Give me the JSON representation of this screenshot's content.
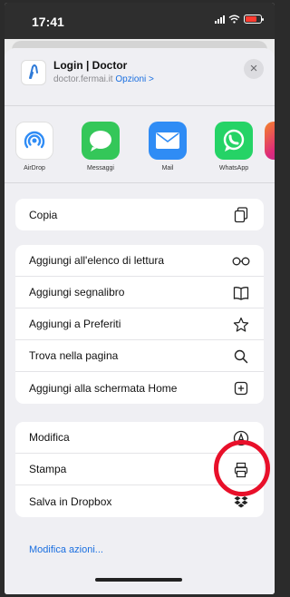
{
  "status_bar": {
    "time": "17:41"
  },
  "share_header": {
    "title": "Login | Doctor",
    "url": "doctor.fermai.it",
    "options_label": "Opzioni >",
    "close_label": "×"
  },
  "apps": [
    {
      "label": "AirDrop",
      "icon": "airdrop-icon"
    },
    {
      "label": "Messaggi",
      "icon": "messages-icon"
    },
    {
      "label": "Mail",
      "icon": "mail-icon"
    },
    {
      "label": "WhatsApp",
      "icon": "whatsapp-icon"
    },
    {
      "label": "I",
      "icon": "instagram-icon"
    }
  ],
  "actions": {
    "copy": {
      "label": "Copia",
      "icon": "copy-icon"
    },
    "group2": [
      {
        "label": "Aggiungi all'elenco di lettura",
        "icon": "glasses-icon"
      },
      {
        "label": "Aggiungi segnalibro",
        "icon": "book-icon"
      },
      {
        "label": "Aggiungi a Preferiti",
        "icon": "star-icon"
      },
      {
        "label": "Trova nella pagina",
        "icon": "search-icon"
      },
      {
        "label": "Aggiungi alla schermata Home",
        "icon": "add-square-icon"
      }
    ],
    "group3": [
      {
        "label": "Modifica",
        "icon": "markup-icon"
      },
      {
        "label": "Stampa",
        "icon": "printer-icon"
      },
      {
        "label": "Salva in Dropbox",
        "icon": "dropbox-icon"
      }
    ]
  },
  "edit_actions_label": "Modifica azioni...",
  "colors": {
    "accent": "#1a6fe0",
    "annotation": "#e8102a",
    "mail": "#2f8cf5",
    "messages": "#34c759",
    "whatsapp": "#25d366"
  }
}
